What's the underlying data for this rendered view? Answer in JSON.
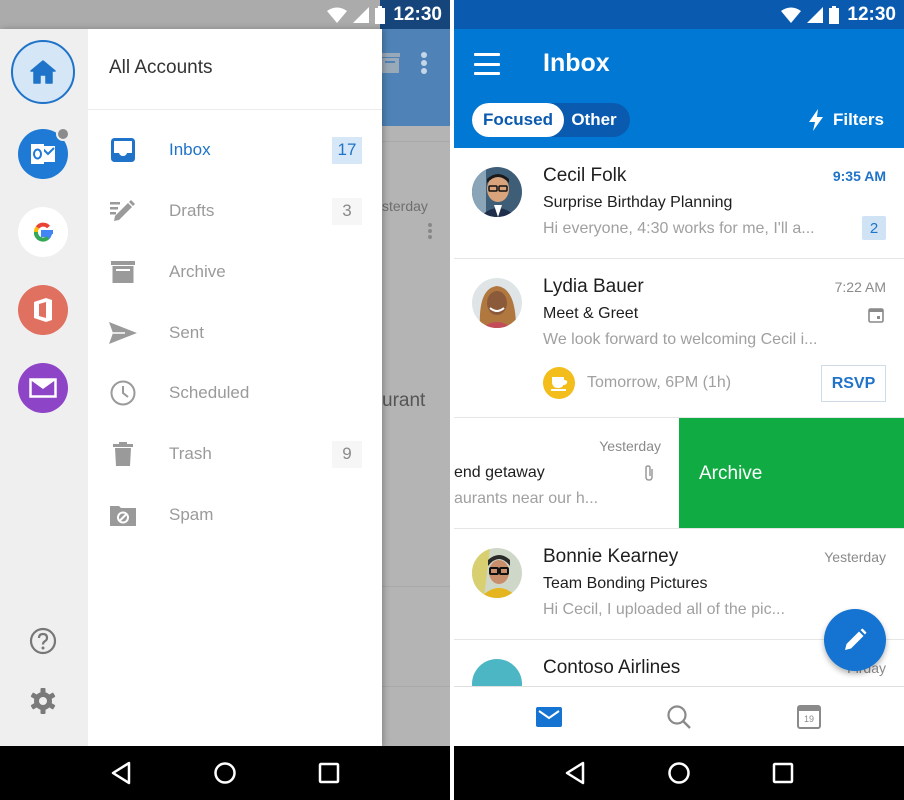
{
  "status_bar": {
    "time": "12:30"
  },
  "colors": {
    "brand_blue": "#0078d4",
    "accent_blue": "#1f73c8",
    "archive_green": "#11ab44",
    "unread_badge_bg": "#cfe3f5"
  },
  "left_screen": {
    "background_inbox": {
      "partial_time": "sterday",
      "partial_text": "urant"
    },
    "account_rail": {
      "accounts": [
        {
          "name": "All Accounts",
          "icon": "home-icon",
          "selected": true
        },
        {
          "name": "Outlook",
          "icon": "outlook-icon",
          "has_badge": true
        },
        {
          "name": "Google",
          "icon": "google-icon"
        },
        {
          "name": "Office 365",
          "icon": "office-icon"
        },
        {
          "name": "Mail",
          "icon": "mail-icon"
        }
      ],
      "bottom_icons": [
        "help-icon",
        "settings-icon"
      ]
    },
    "drawer": {
      "title": "All Accounts",
      "folders": [
        {
          "label": "Inbox",
          "icon": "inbox-icon",
          "count": "17",
          "active": true
        },
        {
          "label": "Drafts",
          "icon": "drafts-icon",
          "count": "3"
        },
        {
          "label": "Archive",
          "icon": "archive-icon",
          "count": ""
        },
        {
          "label": "Sent",
          "icon": "sent-icon",
          "count": ""
        },
        {
          "label": "Scheduled",
          "icon": "clock-icon",
          "count": ""
        },
        {
          "label": "Trash",
          "icon": "trash-icon",
          "count": "9"
        },
        {
          "label": "Spam",
          "icon": "spam-icon",
          "count": ""
        }
      ]
    }
  },
  "right_screen": {
    "header": {
      "title": "Inbox",
      "pivot": {
        "focused": "Focused",
        "other": "Other",
        "selected": "Focused"
      },
      "filters_label": "Filters"
    },
    "messages": [
      {
        "sender": "Cecil Folk",
        "time": "9:35 AM",
        "unread": true,
        "subject": "Surprise Birthday Planning",
        "preview": "Hi everyone, 4:30 works for me, I'll a...",
        "thread_count": "2"
      },
      {
        "sender": "Lydia Bauer",
        "time": "7:22 AM",
        "subject": "Meet & Greet",
        "preview": "We look forward to welcoming Cecil i...",
        "event_time": "Tomorrow, 6PM (1h)",
        "rsvp_label": "RSVP"
      },
      {
        "sender": "",
        "time": "Yesterday",
        "subject": "end getaway",
        "preview": "aurants near our h...",
        "has_attachment": true,
        "swipe_action": "Archive"
      },
      {
        "sender": "Bonnie Kearney",
        "time": "Yesterday",
        "subject": "Team Bonding Pictures",
        "preview": "Hi Cecil, I uploaded all of the pic..."
      },
      {
        "sender": "Contoso Airlines",
        "time": "Firday"
      }
    ],
    "tabbar": {
      "tabs": [
        {
          "name": "mail",
          "active": true
        },
        {
          "name": "search"
        },
        {
          "name": "calendar",
          "day": "19"
        }
      ]
    }
  }
}
